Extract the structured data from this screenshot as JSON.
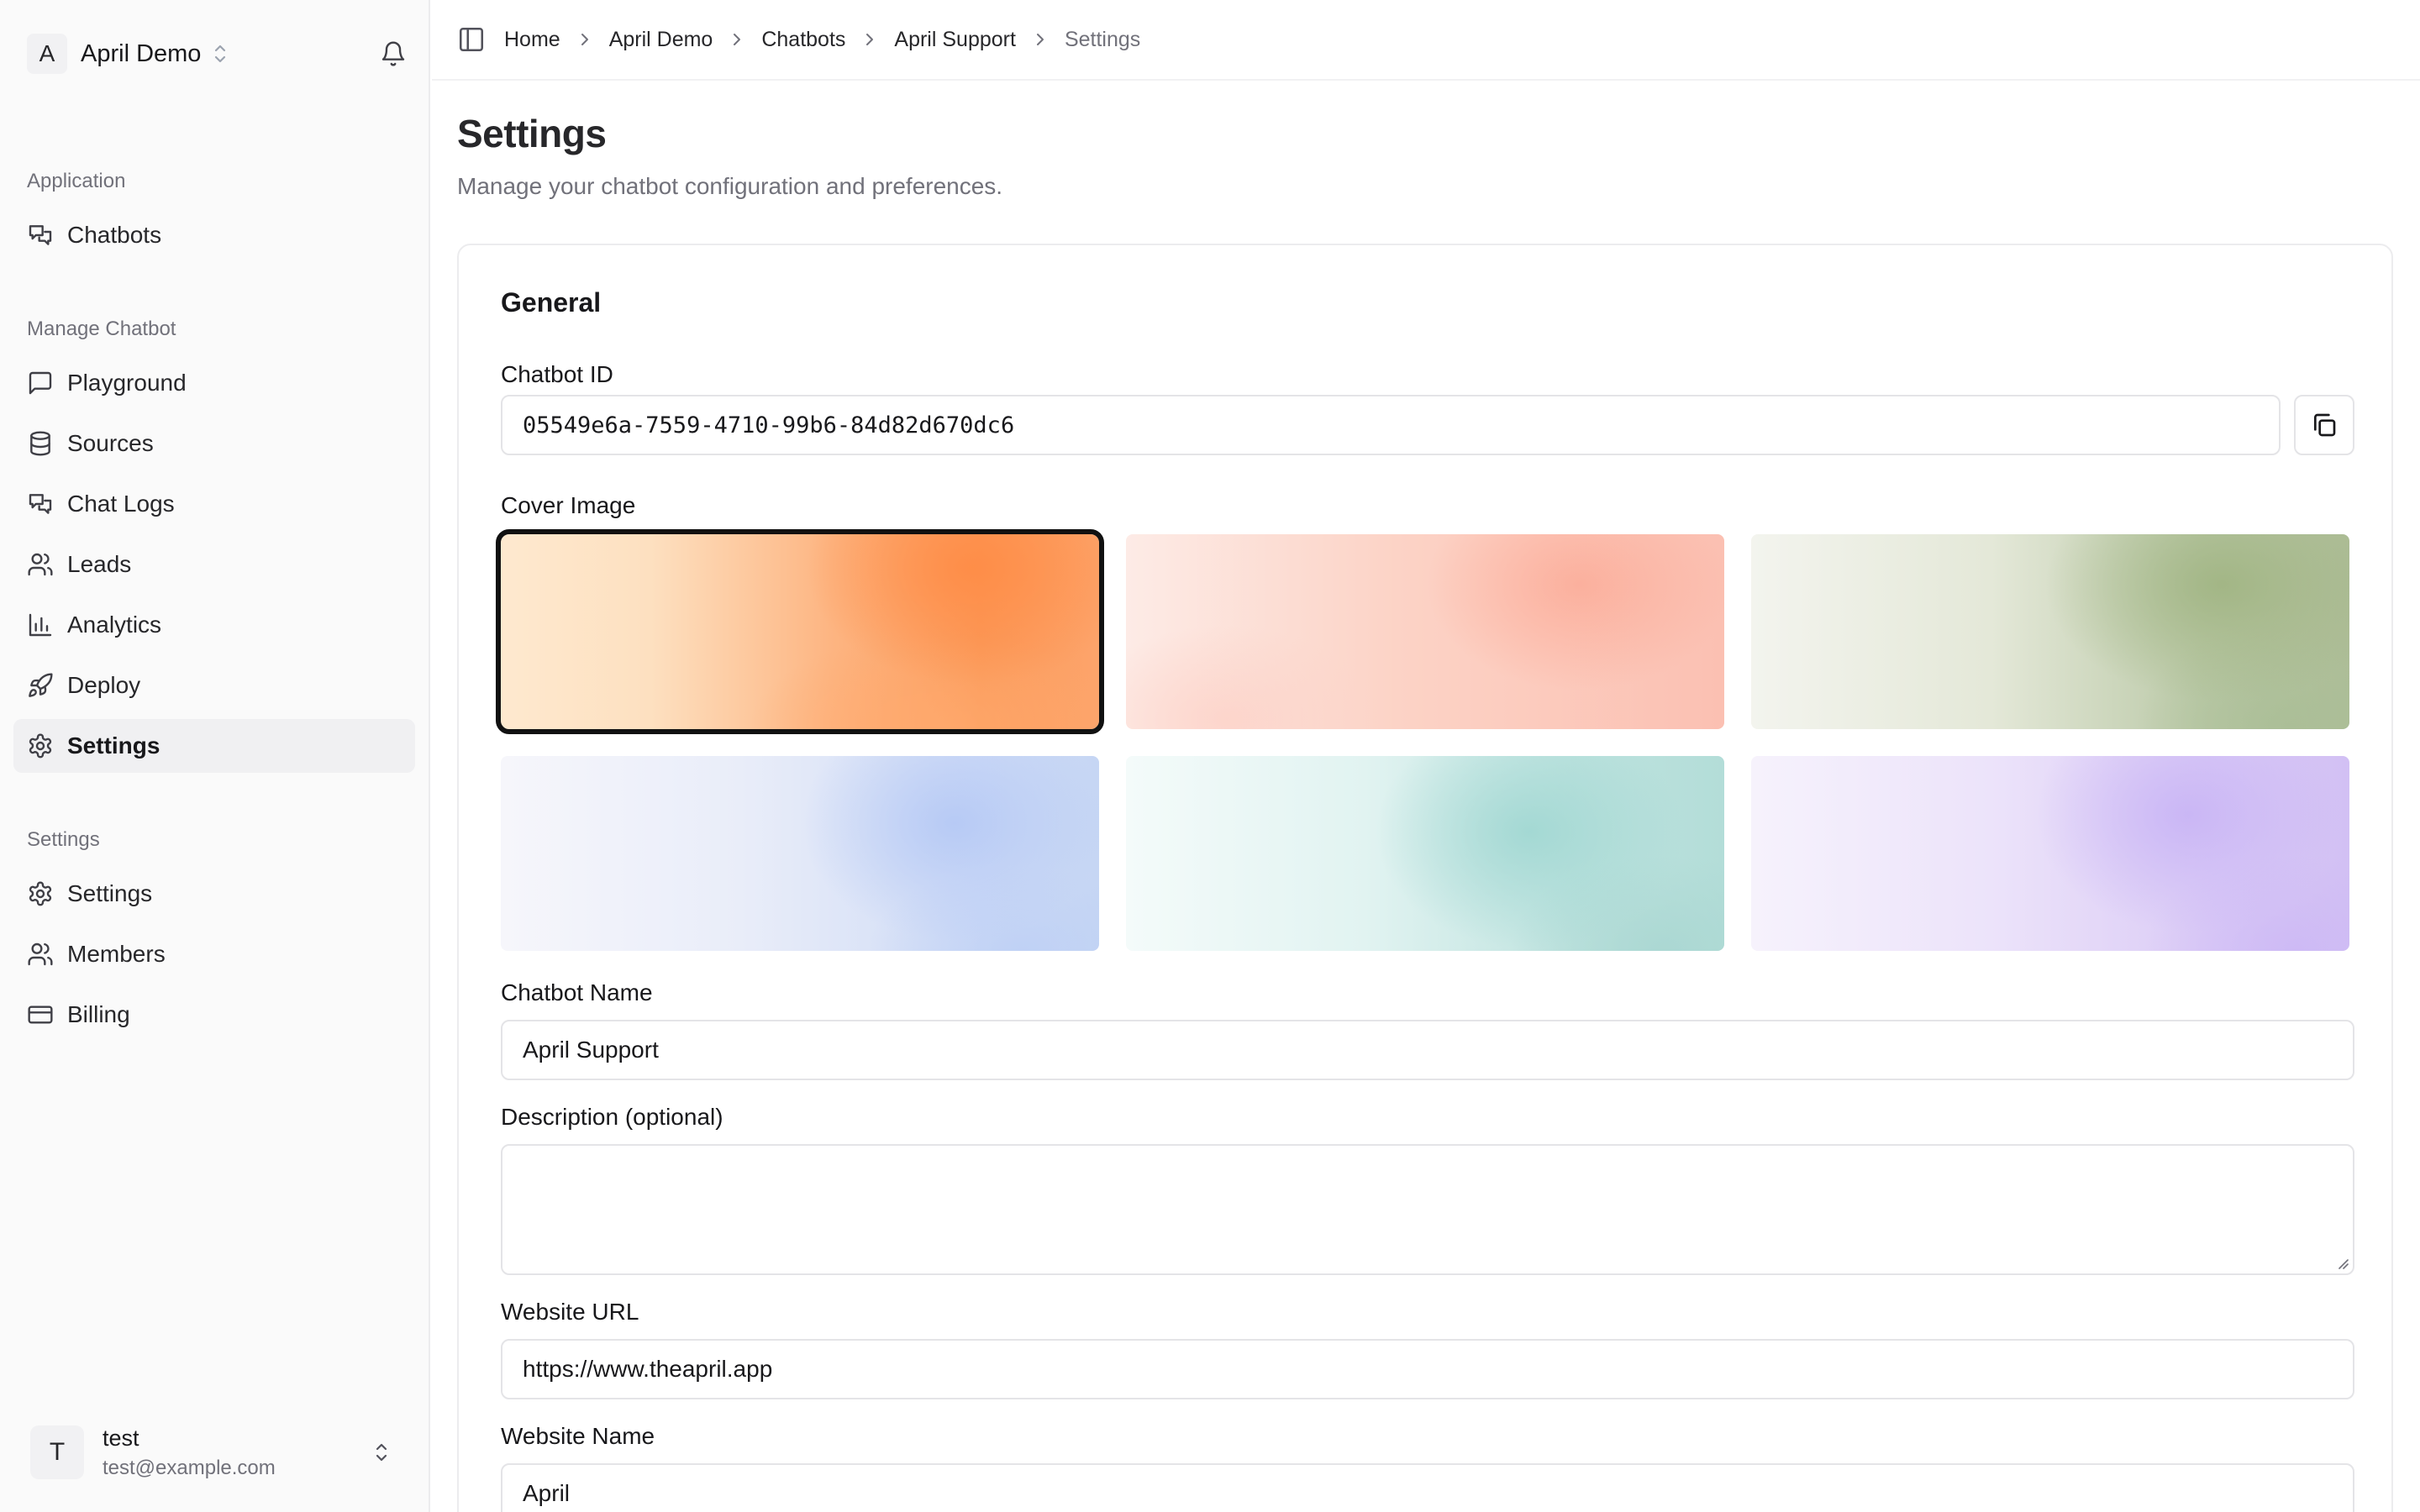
{
  "sidebar": {
    "workspace": {
      "initial": "A",
      "name": "April Demo"
    },
    "sections": [
      {
        "label": "Application",
        "items": [
          {
            "label": "Chatbots",
            "icon": "chats-icon"
          }
        ]
      },
      {
        "label": "Manage Chatbot",
        "items": [
          {
            "label": "Playground",
            "icon": "message-square-icon"
          },
          {
            "label": "Sources",
            "icon": "database-icon"
          },
          {
            "label": "Chat Logs",
            "icon": "chats-icon"
          },
          {
            "label": "Leads",
            "icon": "users-icon"
          },
          {
            "label": "Analytics",
            "icon": "bar-chart-icon"
          },
          {
            "label": "Deploy",
            "icon": "rocket-icon"
          },
          {
            "label": "Settings",
            "icon": "gear-icon",
            "active": true
          }
        ]
      },
      {
        "label": "Settings",
        "items": [
          {
            "label": "Settings",
            "icon": "gear-icon"
          },
          {
            "label": "Members",
            "icon": "users-icon"
          },
          {
            "label": "Billing",
            "icon": "credit-card-icon"
          }
        ]
      }
    ],
    "user": {
      "initial": "T",
      "name": "test",
      "email": "test@example.com"
    }
  },
  "breadcrumb": [
    "Home",
    "April Demo",
    "Chatbots",
    "April Support",
    "Settings"
  ],
  "page": {
    "title": "Settings",
    "subtitle": "Manage your chatbot configuration and preferences."
  },
  "general": {
    "title": "General",
    "chatbot_id_label": "Chatbot ID",
    "chatbot_id": "05549e6a-7559-4710-99b6-84d82d670dc6",
    "cover_image_label": "Cover Image",
    "cover_images": [
      {
        "name": "orange",
        "selected": true
      },
      {
        "name": "peach",
        "selected": false
      },
      {
        "name": "sage",
        "selected": false
      },
      {
        "name": "blue",
        "selected": false
      },
      {
        "name": "teal",
        "selected": false
      },
      {
        "name": "lavender",
        "selected": false
      }
    ],
    "chatbot_name_label": "Chatbot Name",
    "chatbot_name": "April Support",
    "description_label": "Description (optional)",
    "description": "",
    "website_url_label": "Website URL",
    "website_url": "https://www.theapril.app",
    "website_name_label": "Website Name",
    "website_name": "April"
  },
  "colors": {
    "accent": "#18181b",
    "muted": "#71717a",
    "border": "#e4e4e7",
    "sidebar_bg": "#fafafa"
  }
}
